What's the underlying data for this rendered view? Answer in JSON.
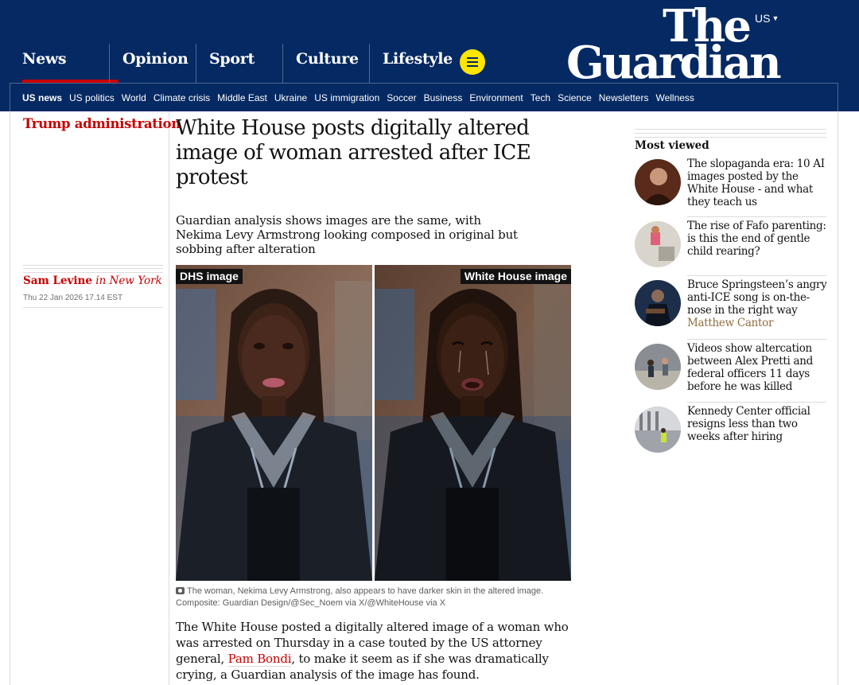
{
  "masthead": {
    "edition": "US",
    "logo_line1": "The",
    "logo_line2": "Guardian",
    "pillars": [
      "News",
      "Opinion",
      "Sport",
      "Culture",
      "Lifestyle"
    ],
    "subnav": [
      "US news",
      "US politics",
      "World",
      "Climate crisis",
      "Middle East",
      "Ukraine",
      "US immigration",
      "Soccer",
      "Business",
      "Environment",
      "Tech",
      "Science",
      "Newsletters",
      "Wellness"
    ]
  },
  "article": {
    "section": "Trump administration",
    "headline": "White House posts digitally altered image of woman arrested after ICE protest",
    "standfirst": "Guardian analysis shows images are the same, with Nekima Levy Armstrong looking composed in original but sobbing after alteration",
    "author": "Sam Levine",
    "location": "in New York",
    "date": "Thu 22 Jan 2026 17.14 EST",
    "image_tag_left": "DHS image",
    "image_tag_right": "White House image",
    "caption_line1": "The woman, Nekima Levy Armstrong, also appears to have darker skin in the altered image.",
    "caption_line2": "Composite: Guardian Design/@Sec_Noem via X/@WhiteHouse via X",
    "body_before": "The White House posted a digitally altered image of a woman who was arrested on Thursday in a case touted by the US attorney general, ",
    "body_link": "Pam Bondi",
    "body_after": ", to make it seem as if she was dramatically crying, a Guardian analysis of the image has found."
  },
  "most_viewed": {
    "title": "Most viewed",
    "items": [
      {
        "text": "The slopaganda era: 10 AI images posted by the White House - and what they teach us",
        "byline": ""
      },
      {
        "text": "The rise of Fafo parenting: is this the end of gentle child rearing?",
        "byline": ""
      },
      {
        "text": "Bruce Springsteen’s angry anti-ICE song is on-the-nose in the right way",
        "byline": "Matthew Cantor"
      },
      {
        "text": "Videos show altercation between Alex Pretti and federal officers 11 days before he was killed",
        "byline": ""
      },
      {
        "text": "Kennedy Center official resigns less than two weeks after hiring",
        "byline": ""
      }
    ]
  },
  "colors": {
    "brand_blue": "#052962",
    "news_red": "#c70000",
    "menu_yellow": "#ffe500",
    "byline_brown": "#8d6e3f"
  },
  "icons": [
    "menu-icon",
    "chevron-down-icon",
    "camera-icon"
  ]
}
